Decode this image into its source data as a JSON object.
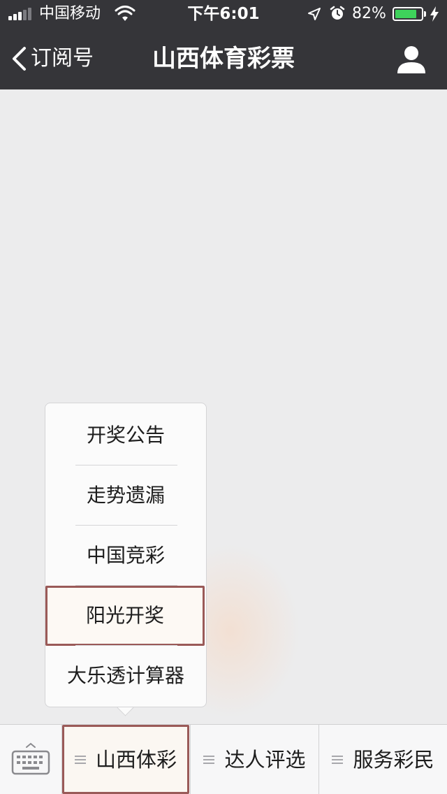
{
  "status_bar": {
    "carrier": "中国移动",
    "time": "下午6:01",
    "battery_percent": "82%",
    "battery_level": 0.82,
    "icons": [
      "signal-icon",
      "wifi-icon",
      "location-arrow-icon",
      "alarm-clock-icon",
      "battery-icon",
      "charging-bolt-icon"
    ]
  },
  "nav": {
    "back_label": "订阅号",
    "title": "山西体育彩票",
    "back_icon": "chevron-left-icon",
    "profile_icon": "person-icon"
  },
  "popup_menu": {
    "items": [
      "开奖公告",
      "走势遗漏",
      "中国竞彩",
      "阳光开奖",
      "大乐透计算器"
    ],
    "highlighted_index": 3
  },
  "bottom_bar": {
    "keyboard_icon": "keyboard-icon",
    "menu_icon": "menu-lines-icon",
    "tabs": [
      "山西体彩",
      "达人评选",
      "服务彩民"
    ],
    "active_index": 0
  },
  "colors": {
    "header_bg": "#353539",
    "content_bg": "#ececed",
    "highlight_border": "#9a5a58",
    "battery_green": "#3ed25b"
  }
}
